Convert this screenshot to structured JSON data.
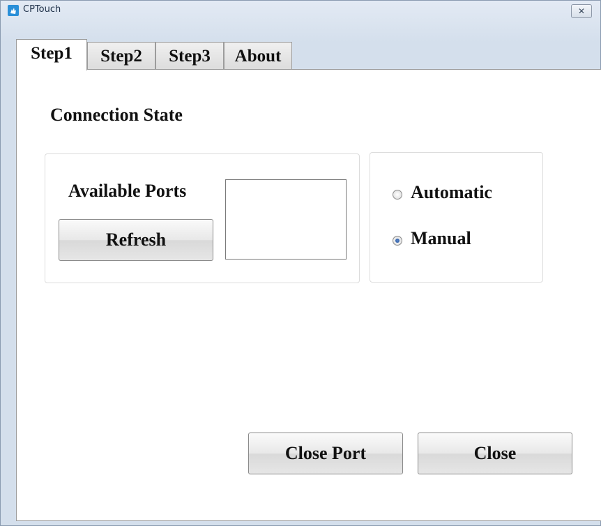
{
  "window": {
    "title": "CPTouch",
    "close_glyph": "✕"
  },
  "tabs": [
    {
      "label": "Step1",
      "active": true
    },
    {
      "label": "Step2",
      "active": false
    },
    {
      "label": "Step3",
      "active": false
    },
    {
      "label": "About",
      "active": false
    }
  ],
  "connection": {
    "heading": "Connection State",
    "available_ports_label": "Available Ports",
    "refresh_label": "Refresh",
    "ports_list": []
  },
  "mode": {
    "automatic_label": "Automatic",
    "manual_label": "Manual",
    "selected": "Manual"
  },
  "footer": {
    "close_port_label": "Close Port",
    "close_label": "Close"
  },
  "colors": {
    "title_bar": "#d4dfec",
    "radio_selected": "#1e4f9a"
  }
}
